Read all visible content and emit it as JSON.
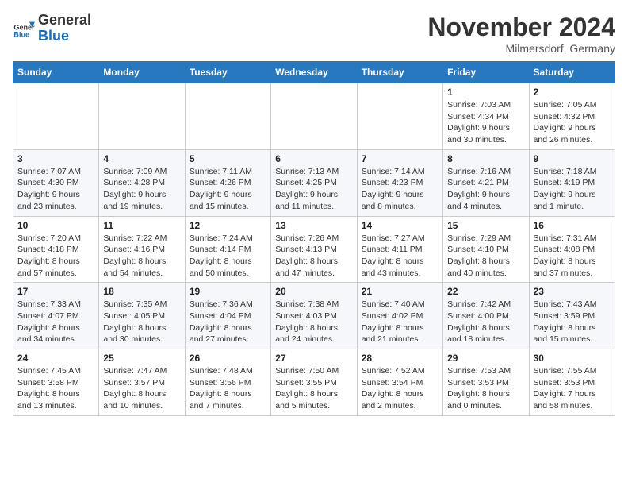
{
  "header": {
    "logo_general": "General",
    "logo_blue": "Blue",
    "month_title": "November 2024",
    "location": "Milmersdorf, Germany"
  },
  "weekdays": [
    "Sunday",
    "Monday",
    "Tuesday",
    "Wednesday",
    "Thursday",
    "Friday",
    "Saturday"
  ],
  "weeks": [
    [
      {
        "day": "",
        "info": ""
      },
      {
        "day": "",
        "info": ""
      },
      {
        "day": "",
        "info": ""
      },
      {
        "day": "",
        "info": ""
      },
      {
        "day": "",
        "info": ""
      },
      {
        "day": "1",
        "info": "Sunrise: 7:03 AM\nSunset: 4:34 PM\nDaylight: 9 hours\nand 30 minutes."
      },
      {
        "day": "2",
        "info": "Sunrise: 7:05 AM\nSunset: 4:32 PM\nDaylight: 9 hours\nand 26 minutes."
      }
    ],
    [
      {
        "day": "3",
        "info": "Sunrise: 7:07 AM\nSunset: 4:30 PM\nDaylight: 9 hours\nand 23 minutes."
      },
      {
        "day": "4",
        "info": "Sunrise: 7:09 AM\nSunset: 4:28 PM\nDaylight: 9 hours\nand 19 minutes."
      },
      {
        "day": "5",
        "info": "Sunrise: 7:11 AM\nSunset: 4:26 PM\nDaylight: 9 hours\nand 15 minutes."
      },
      {
        "day": "6",
        "info": "Sunrise: 7:13 AM\nSunset: 4:25 PM\nDaylight: 9 hours\nand 11 minutes."
      },
      {
        "day": "7",
        "info": "Sunrise: 7:14 AM\nSunset: 4:23 PM\nDaylight: 9 hours\nand 8 minutes."
      },
      {
        "day": "8",
        "info": "Sunrise: 7:16 AM\nSunset: 4:21 PM\nDaylight: 9 hours\nand 4 minutes."
      },
      {
        "day": "9",
        "info": "Sunrise: 7:18 AM\nSunset: 4:19 PM\nDaylight: 9 hours\nand 1 minute."
      }
    ],
    [
      {
        "day": "10",
        "info": "Sunrise: 7:20 AM\nSunset: 4:18 PM\nDaylight: 8 hours\nand 57 minutes."
      },
      {
        "day": "11",
        "info": "Sunrise: 7:22 AM\nSunset: 4:16 PM\nDaylight: 8 hours\nand 54 minutes."
      },
      {
        "day": "12",
        "info": "Sunrise: 7:24 AM\nSunset: 4:14 PM\nDaylight: 8 hours\nand 50 minutes."
      },
      {
        "day": "13",
        "info": "Sunrise: 7:26 AM\nSunset: 4:13 PM\nDaylight: 8 hours\nand 47 minutes."
      },
      {
        "day": "14",
        "info": "Sunrise: 7:27 AM\nSunset: 4:11 PM\nDaylight: 8 hours\nand 43 minutes."
      },
      {
        "day": "15",
        "info": "Sunrise: 7:29 AM\nSunset: 4:10 PM\nDaylight: 8 hours\nand 40 minutes."
      },
      {
        "day": "16",
        "info": "Sunrise: 7:31 AM\nSunset: 4:08 PM\nDaylight: 8 hours\nand 37 minutes."
      }
    ],
    [
      {
        "day": "17",
        "info": "Sunrise: 7:33 AM\nSunset: 4:07 PM\nDaylight: 8 hours\nand 34 minutes."
      },
      {
        "day": "18",
        "info": "Sunrise: 7:35 AM\nSunset: 4:05 PM\nDaylight: 8 hours\nand 30 minutes."
      },
      {
        "day": "19",
        "info": "Sunrise: 7:36 AM\nSunset: 4:04 PM\nDaylight: 8 hours\nand 27 minutes."
      },
      {
        "day": "20",
        "info": "Sunrise: 7:38 AM\nSunset: 4:03 PM\nDaylight: 8 hours\nand 24 minutes."
      },
      {
        "day": "21",
        "info": "Sunrise: 7:40 AM\nSunset: 4:02 PM\nDaylight: 8 hours\nand 21 minutes."
      },
      {
        "day": "22",
        "info": "Sunrise: 7:42 AM\nSunset: 4:00 PM\nDaylight: 8 hours\nand 18 minutes."
      },
      {
        "day": "23",
        "info": "Sunrise: 7:43 AM\nSunset: 3:59 PM\nDaylight: 8 hours\nand 15 minutes."
      }
    ],
    [
      {
        "day": "24",
        "info": "Sunrise: 7:45 AM\nSunset: 3:58 PM\nDaylight: 8 hours\nand 13 minutes."
      },
      {
        "day": "25",
        "info": "Sunrise: 7:47 AM\nSunset: 3:57 PM\nDaylight: 8 hours\nand 10 minutes."
      },
      {
        "day": "26",
        "info": "Sunrise: 7:48 AM\nSunset: 3:56 PM\nDaylight: 8 hours\nand 7 minutes."
      },
      {
        "day": "27",
        "info": "Sunrise: 7:50 AM\nSunset: 3:55 PM\nDaylight: 8 hours\nand 5 minutes."
      },
      {
        "day": "28",
        "info": "Sunrise: 7:52 AM\nSunset: 3:54 PM\nDaylight: 8 hours\nand 2 minutes."
      },
      {
        "day": "29",
        "info": "Sunrise: 7:53 AM\nSunset: 3:53 PM\nDaylight: 8 hours\nand 0 minutes."
      },
      {
        "day": "30",
        "info": "Sunrise: 7:55 AM\nSunset: 3:53 PM\nDaylight: 7 hours\nand 58 minutes."
      }
    ]
  ]
}
